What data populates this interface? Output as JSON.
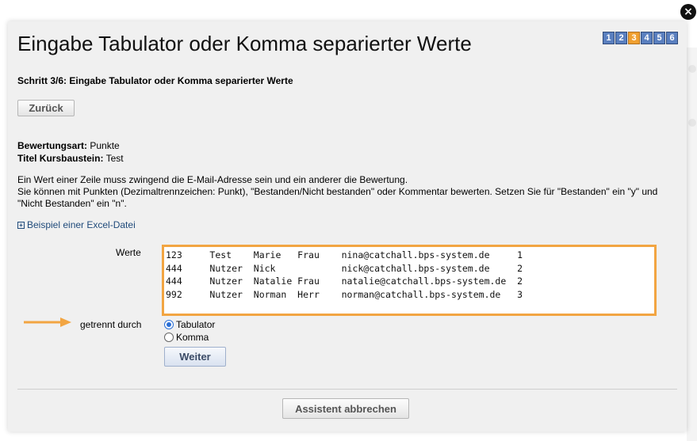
{
  "dialog": {
    "title": "Eingabe Tabulator oder Komma separierter Werte",
    "step_label": "Schritt 3/6: Eingabe Tabulator oder Komma separierter Werte",
    "steps": [
      "1",
      "2",
      "3",
      "4",
      "5",
      "6"
    ],
    "active_step": "3",
    "back_label": "Zurück",
    "close_icon": "×"
  },
  "info": {
    "rating_type_label": "Bewertungsart:",
    "rating_type_value": " Punkte",
    "course_title_label": "Titel Kursbaustein:",
    "course_title_value": " Test"
  },
  "description": {
    "line1": "Ein Wert einer Zeile muss zwingend die E-Mail-Adresse sein und ein anderer die Bewertung.",
    "line2": "Sie können mit Punkten (Dezimaltrennzeichen: Punkt), \"Bestanden/Nicht bestanden\" oder Kommentar bewerten. Setzen Sie für \"Bestanden\" ein \"y\" und \"Nicht Bestanden\" ein \"n\"."
  },
  "example_link": "Beispiel einer Excel-Datei",
  "values": {
    "label": "Werte",
    "rows": [
      "123\tTest\tMarie\tFrau\tnina@catchall.bps-system.de\t1",
      "444\tNutzer\tNick\t\tnick@catchall.bps-system.de\t2",
      "444\tNutzer\tNatalie\tFrau\tnatalie@catchall.bps-system.de\t2",
      "992\tNutzer\tNorman\tHerr\tnorman@catchall.bps-system.de\t3"
    ]
  },
  "separator": {
    "label": "getrennt durch",
    "options": [
      "Tabulator",
      "Komma"
    ],
    "selected": "Tabulator"
  },
  "next_label": "Weiter",
  "cancel_label": "Assistent abbrechen",
  "colors": {
    "highlight": "#f2a542",
    "step_active": "#f0a030",
    "step": "#5a7fbf"
  }
}
